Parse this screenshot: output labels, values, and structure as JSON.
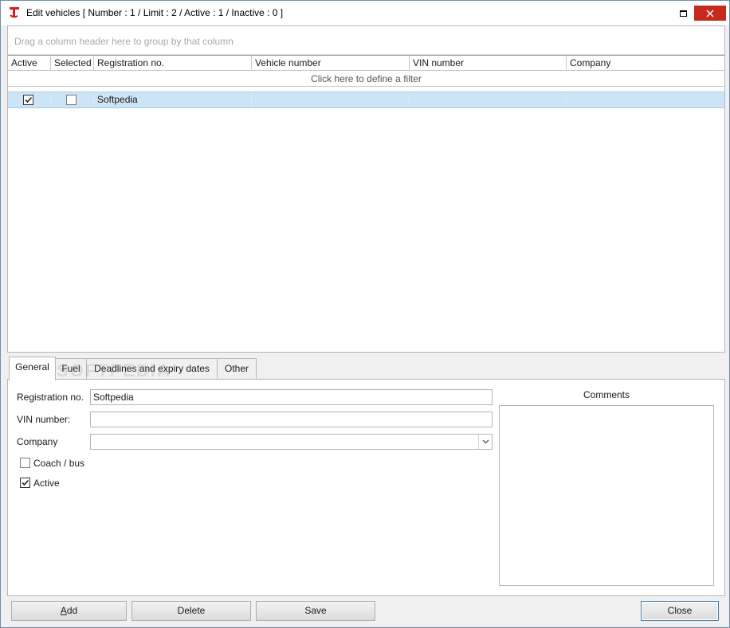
{
  "window": {
    "title": "Edit vehicles [ Number : 1 / Limit : 2 / Active : 1 / Inactive : 0 ]"
  },
  "icons": {
    "app": "app-logo-icon",
    "maximize": "maximize-icon",
    "close": "close-icon",
    "checkmark": "check-icon",
    "dropdown": "chevron-down-icon"
  },
  "grid": {
    "group_hint": "Drag a column header here to group by that column",
    "columns": [
      "Active",
      "Selected",
      "Registration no.",
      "Vehicle number",
      "VIN number",
      "Company"
    ],
    "filter_hint": "Click here to define a filter",
    "rows": [
      {
        "active": true,
        "selected": false,
        "registration": "Softpedia",
        "vehicle_number": "",
        "vin": "",
        "company": ""
      }
    ]
  },
  "tabs": [
    "General",
    "Fuel",
    "Deadlines and expiry dates",
    "Other"
  ],
  "form": {
    "registration_label": "Registration no.",
    "registration_value": "Softpedia",
    "vin_label": "VIN number:",
    "vin_value": "",
    "company_label": "Company",
    "company_value": "",
    "coach_label": "Coach / bus",
    "coach_checked": false,
    "active_label": "Active",
    "active_checked": true,
    "comments_label": "Comments",
    "comments_value": ""
  },
  "buttons": {
    "add": "Add",
    "delete": "Delete",
    "save": "Save",
    "close": "Close"
  },
  "colors": {
    "selected_row": "#cde4f7",
    "close_button": "#c42b1c",
    "app_icon": "#d02020"
  },
  "watermark": "SOFTPEDIA"
}
